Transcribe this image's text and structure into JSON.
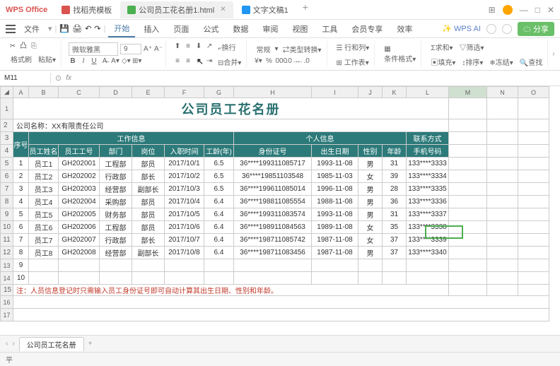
{
  "app": {
    "name": "WPS Office"
  },
  "tabs": [
    {
      "label": "找稻壳模板",
      "icon": "red"
    },
    {
      "label": "公司员工花名册1.html",
      "icon": "green",
      "active": true
    },
    {
      "label": "文字文稿1",
      "icon": "blue"
    }
  ],
  "menu": {
    "file": "文件",
    "items": [
      "开始",
      "插入",
      "页面",
      "公式",
      "数据",
      "审阅",
      "视图",
      "工具",
      "会员专享",
      "效率"
    ],
    "active": "开始",
    "ai": "WPS AI",
    "share": "分享"
  },
  "ribbon": {
    "fmt_brush": "格式刷",
    "paste": "粘贴",
    "font": "微软雅黑",
    "size": "9",
    "wrap": "换行",
    "merge": "合并",
    "general": "常规",
    "type_convert": "类型转换",
    "row_col": "行和列",
    "worksheet": "工作表",
    "cond_fmt": "条件格式",
    "sum": "求和",
    "filter": "筛选",
    "fill": "填充",
    "sort": "排序",
    "freeze": "冻结",
    "find": "查找"
  },
  "namebox": "M11",
  "fx": "fx",
  "columns": [
    "A",
    "B",
    "C",
    "D",
    "E",
    "F",
    "G",
    "H",
    "I",
    "J",
    "K",
    "L",
    "M",
    "N",
    "O"
  ],
  "title": "公司员工花名册",
  "company_label": "公司名称：XX有限责任公司",
  "hdr": {
    "seq": "序号",
    "work": "工作信息",
    "personal": "个人信息",
    "contact": "联系方式",
    "name": "员工姓名",
    "id": "员工工号",
    "dept": "部门",
    "pos": "岗位",
    "hire": "入职时间",
    "yrs": "工龄(年)",
    "idcard": "身份证号",
    "birth": "出生日期",
    "sex": "性别",
    "age": "年龄",
    "phone": "手机号码"
  },
  "rows": [
    {
      "n": "1",
      "name": "员工1",
      "id": "GH202001",
      "dept": "工程部",
      "pos": "部员",
      "hire": "2017/10/1",
      "yrs": "6.5",
      "idc": "36****199311085717",
      "birth": "1993-11-08",
      "sex": "男",
      "age": "31",
      "phone": "133****3333"
    },
    {
      "n": "2",
      "name": "员工2",
      "id": "GH202002",
      "dept": "行政部",
      "pos": "部长",
      "hire": "2017/10/2",
      "yrs": "6.5",
      "idc": "36****19851103548",
      "birth": "1985-11-03",
      "sex": "女",
      "age": "39",
      "phone": "133****3334"
    },
    {
      "n": "3",
      "name": "员工3",
      "id": "GH202003",
      "dept": "经营部",
      "pos": "副部长",
      "hire": "2017/10/3",
      "yrs": "6.5",
      "idc": "36****199611085014",
      "birth": "1996-11-08",
      "sex": "男",
      "age": "28",
      "phone": "133****3335"
    },
    {
      "n": "4",
      "name": "员工4",
      "id": "GH202004",
      "dept": "采购部",
      "pos": "部员",
      "hire": "2017/10/4",
      "yrs": "6.4",
      "idc": "36****198811085554",
      "birth": "1988-11-08",
      "sex": "男",
      "age": "36",
      "phone": "133****3336"
    },
    {
      "n": "5",
      "name": "员工5",
      "id": "GH202005",
      "dept": "财务部",
      "pos": "部员",
      "hire": "2017/10/5",
      "yrs": "6.4",
      "idc": "36****199311083574",
      "birth": "1993-11-08",
      "sex": "男",
      "age": "31",
      "phone": "133****3337"
    },
    {
      "n": "6",
      "name": "员工6",
      "id": "GH202006",
      "dept": "工程部",
      "pos": "部员",
      "hire": "2017/10/6",
      "yrs": "6.4",
      "idc": "36****198911084563",
      "birth": "1989-11-08",
      "sex": "女",
      "age": "35",
      "phone": "133****3338"
    },
    {
      "n": "7",
      "name": "员工7",
      "id": "GH202007",
      "dept": "行政部",
      "pos": "部长",
      "hire": "2017/10/7",
      "yrs": "6.4",
      "idc": "36****198711085742",
      "birth": "1987-11-08",
      "sex": "女",
      "age": "37",
      "phone": "133****3339"
    },
    {
      "n": "8",
      "name": "员工8",
      "id": "GH202008",
      "dept": "经营部",
      "pos": "副部长",
      "hire": "2017/10/8",
      "yrs": "6.4",
      "idc": "36****198711083456",
      "birth": "1987-11-08",
      "sex": "男",
      "age": "37",
      "phone": "133****3340"
    }
  ],
  "note": "注：人员信息登记时只需输入员工身份证号即可自动计算其出生日期、性别和年龄。",
  "sheet_tab": "公司员工花名册",
  "status": "平"
}
